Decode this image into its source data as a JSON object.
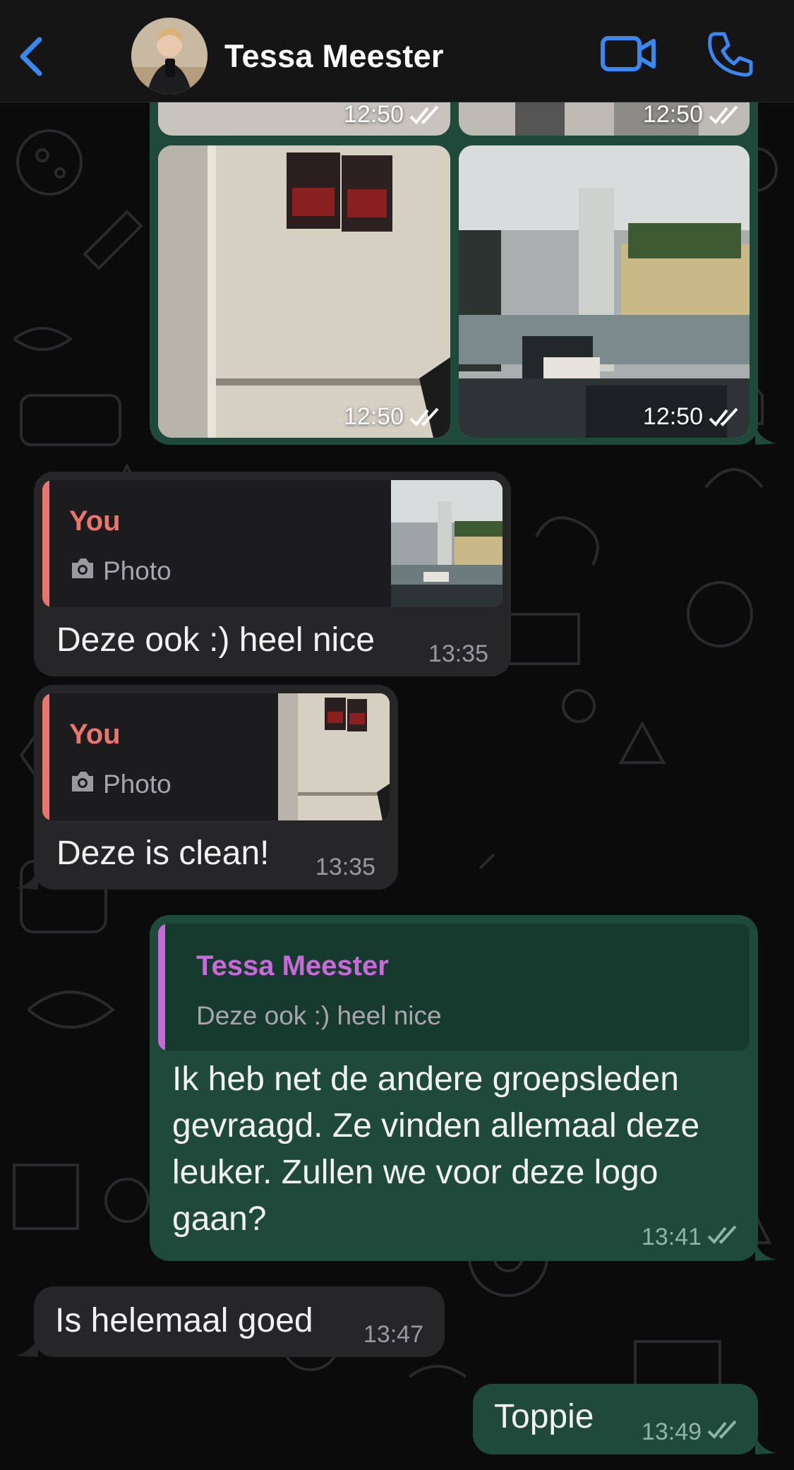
{
  "header": {
    "contact_name": "Tessa Meester",
    "back_icon": "chevron-left-icon",
    "video_icon": "video-camera-icon",
    "call_icon": "phone-icon",
    "accent_color": "#3a87f0"
  },
  "photo_grid": {
    "times": [
      "12:50",
      "12:50",
      "12:50",
      "12:50"
    ],
    "status_icon": "double-check-icon"
  },
  "messages": [
    {
      "direction": "in",
      "quote": {
        "sender": "You",
        "type_icon": "camera-icon",
        "type_label": "Photo"
      },
      "text": "Deze ook :) heel nice",
      "time": "13:35"
    },
    {
      "direction": "in",
      "quote": {
        "sender": "You",
        "type_icon": "camera-icon",
        "type_label": "Photo"
      },
      "text": "Deze is clean!",
      "time": "13:35"
    },
    {
      "direction": "out",
      "quote": {
        "sender": "Tessa Meester",
        "text": "Deze ook :) heel nice"
      },
      "text_lines": [
        "Ik heb net de andere groepsleden",
        "gevraagd. Ze vinden allemaal deze",
        "leuker. Zullen we voor deze logo",
        "gaan?"
      ],
      "time": "13:41"
    },
    {
      "direction": "in",
      "text": "Is helemaal goed",
      "time": "13:47"
    },
    {
      "direction": "out",
      "text": "Toppie",
      "time": "13:49"
    }
  ],
  "colors": {
    "incoming_bubble": "#262628",
    "outgoing_bubble": "#1f4a3b",
    "quote_you": "#e8766e",
    "quote_contact": "#c86ad8"
  }
}
